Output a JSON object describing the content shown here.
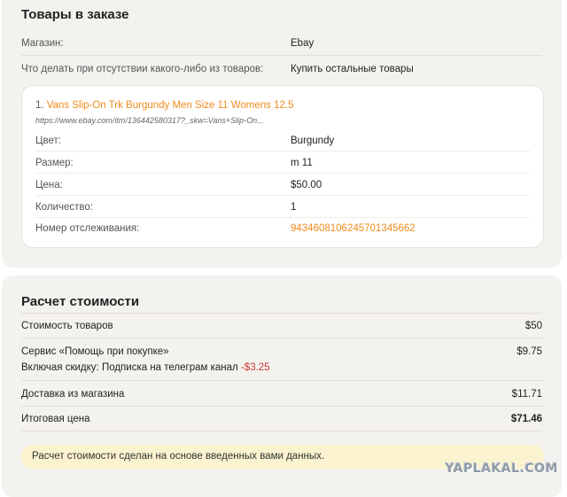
{
  "order": {
    "title": "Товары в заказе",
    "store_label": "Магазин:",
    "store_value": "Ebay",
    "missing_label": "Что делать при отсутствии какого-либо из товаров:",
    "missing_value": "Купить остальные товары",
    "item": {
      "index": "1.",
      "name": "Vans Slip-On Trk Burgundy Men Size 11 Womens 12.5",
      "url": "https://www.ebay.com/itm/136442580317?_skw=Vans+Slip-On...",
      "fields": [
        {
          "label": "Цвет:",
          "value": "Burgundy"
        },
        {
          "label": "Размер:",
          "value": "m 11"
        },
        {
          "label": "Цена:",
          "value": "$50.00"
        },
        {
          "label": "Количество:",
          "value": "1"
        },
        {
          "label": "Номер отслеживания:",
          "value": "9434608106245701345662"
        }
      ]
    }
  },
  "cost": {
    "title": "Расчет стоимости",
    "goods_label": "Стоимость товаров",
    "goods_amount": "$50",
    "service_label": "Сервис «Помощь при покупке»",
    "service_amount": "$9.75",
    "discount_label": "Включая скидку: Подписка на телеграм канал",
    "discount_amount": "-$3.25",
    "delivery_label": "Доставка из магазина",
    "delivery_amount": "$11.71",
    "total_label": "Итоговая цена",
    "total_amount": "$71.46",
    "notice": "Расчет стоимости сделан на основе введенных вами данных."
  },
  "watermark": "YAPLAKAL.COM",
  "colors": {
    "accent": "#f08a1c",
    "discount": "#d0352f",
    "panel": "#f4f2ef",
    "notice": "#fbf3cf"
  }
}
